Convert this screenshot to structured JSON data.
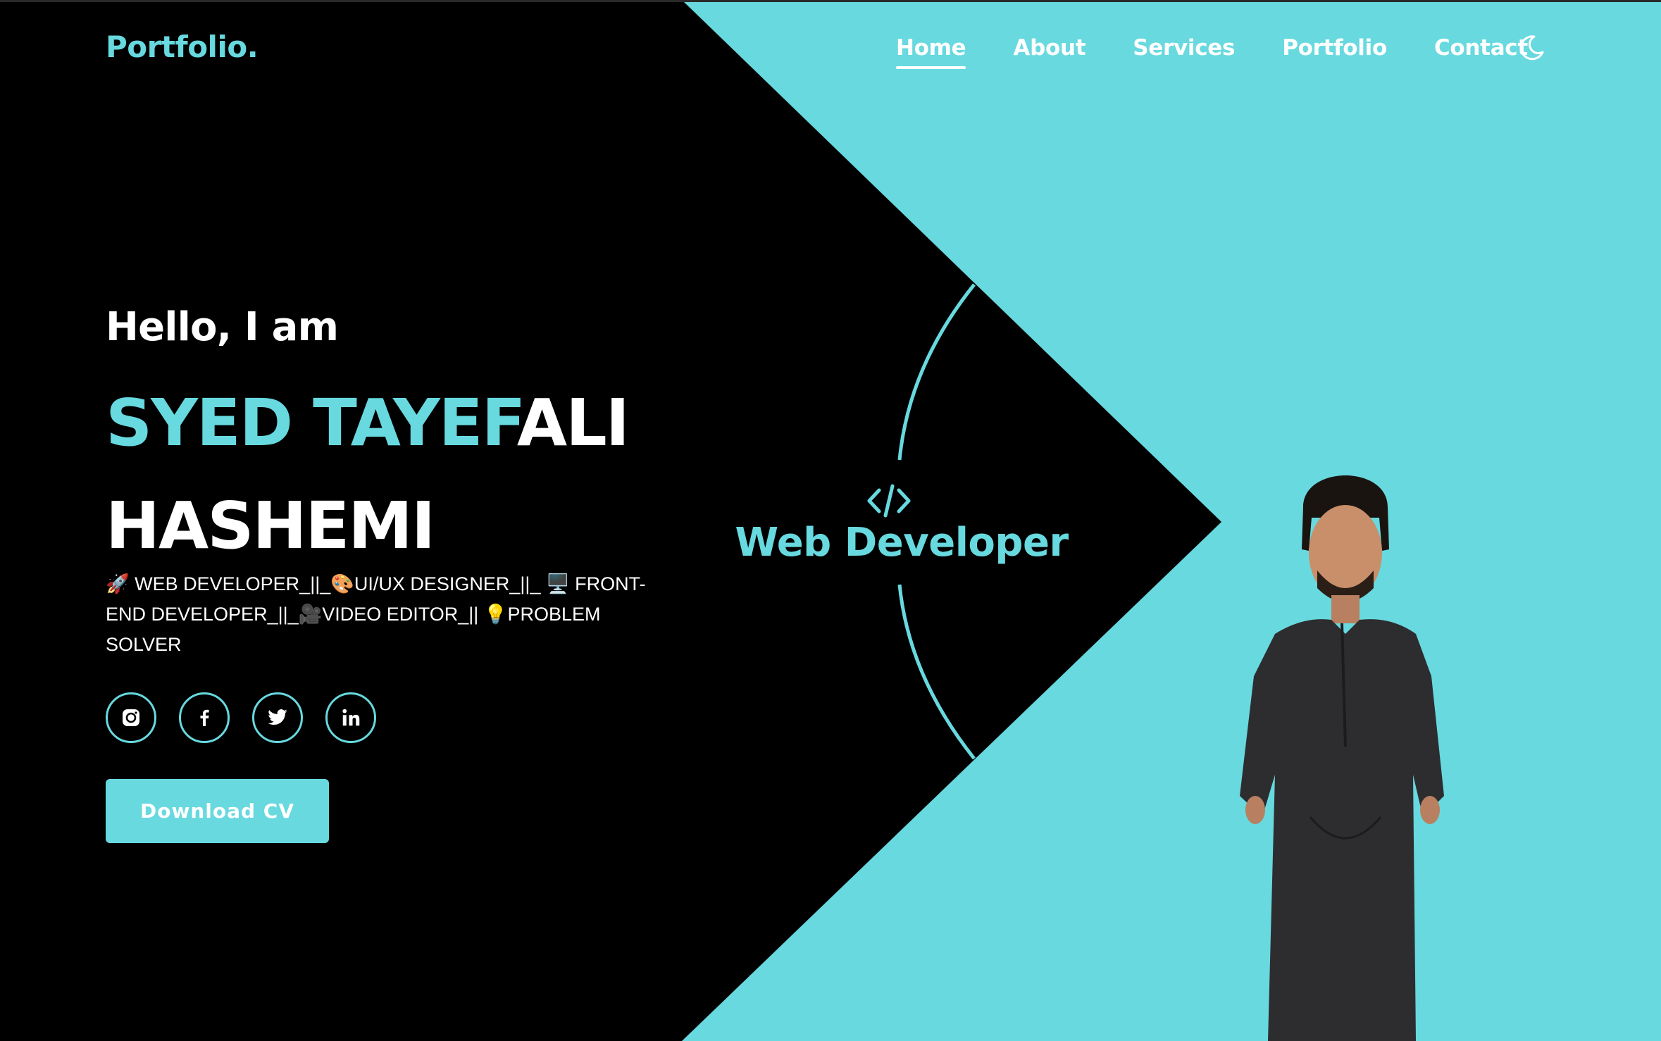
{
  "brand": {
    "logo": "Portfolio."
  },
  "nav": {
    "items": [
      {
        "label": "Home",
        "active": true
      },
      {
        "label": "About",
        "active": false
      },
      {
        "label": "Services",
        "active": false
      },
      {
        "label": "Portfolio",
        "active": false
      },
      {
        "label": "Contact",
        "active": false
      }
    ],
    "theme_toggle_icon": "moon-icon"
  },
  "hero": {
    "greeting": "Hello, I am",
    "name_accent": "SYED TAYEF",
    "name_rest": "ALI",
    "name_line2": "HASHEMI",
    "roles": "🚀 WEB DEVELOPER_||_🎨UI/UX DESIGNER_||_ 🖥️ FRONT-END DEVELOPER_||_🎥VIDEO EDITOR_|| 💡PROBLEM SOLVER",
    "social_icons": [
      "instagram-icon",
      "facebook-icon",
      "twitter-icon",
      "linkedin-icon"
    ],
    "download_label": "Download CV"
  },
  "badge": {
    "icon": "code-icon",
    "title": "Web Developer"
  },
  "colors": {
    "accent": "#67d9df",
    "dark": "#000000",
    "text": "#ffffff"
  }
}
